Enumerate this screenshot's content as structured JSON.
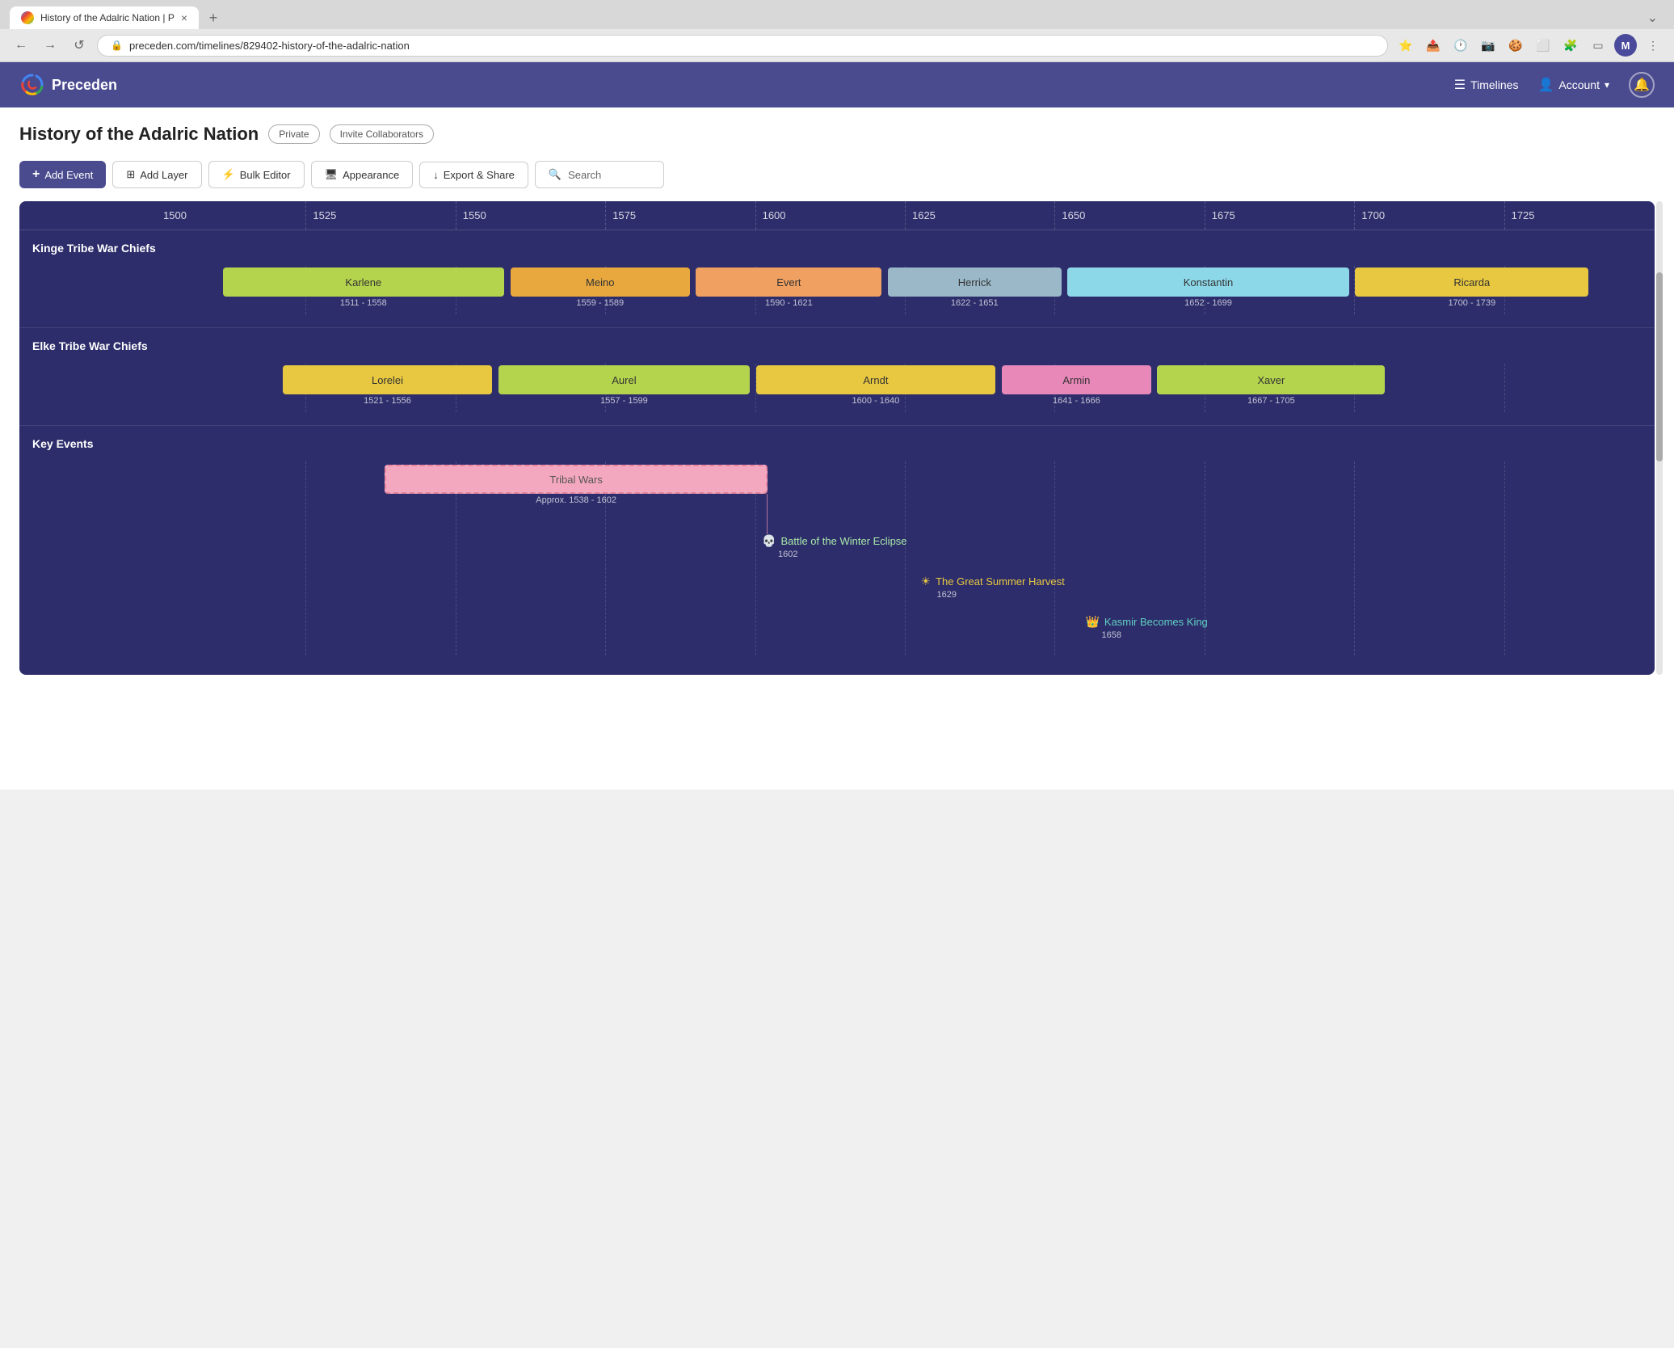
{
  "browser": {
    "tab_title": "History of the Adalric Nation | P",
    "url": "preceden.com/timelines/829402-history-of-the-adalric-nation",
    "profile_letter": "M",
    "new_tab_symbol": "+"
  },
  "header": {
    "logo_text": "Preceden",
    "timelines_label": "Timelines",
    "account_label": "Account"
  },
  "page": {
    "title": "History of the Adalric Nation",
    "private_badge": "Private",
    "invite_badge": "Invite Collaborators"
  },
  "toolbar": {
    "add_event_label": "Add Event",
    "add_layer_label": "Add Layer",
    "bulk_editor_label": "Bulk Editor",
    "appearance_label": "Appearance",
    "export_share_label": "Export & Share",
    "search_placeholder": "Search"
  },
  "timeline": {
    "years": [
      "1500",
      "1525",
      "1550",
      "1575",
      "1600",
      "1625",
      "1650",
      "1675",
      "1700",
      "1725"
    ],
    "sections": [
      {
        "id": "kinge",
        "name": "Kinge Tribe War Chiefs",
        "events": [
          {
            "name": "Karlene",
            "start": 1511,
            "end": 1558,
            "color": "#b5d44e",
            "dates": "1511 - 1558"
          },
          {
            "name": "Meino",
            "start": 1559,
            "end": 1589,
            "color": "#e8a83e",
            "dates": "1559 - 1589"
          },
          {
            "name": "Evert",
            "start": 1590,
            "end": 1621,
            "color": "#f0a060",
            "dates": "1590 - 1621"
          },
          {
            "name": "Herrick",
            "start": 1622,
            "end": 1651,
            "color": "#9ab8c8",
            "dates": "1622 - 1651"
          },
          {
            "name": "Konstantin",
            "start": 1652,
            "end": 1699,
            "color": "#8dd8e8",
            "dates": "1652 - 1699"
          },
          {
            "name": "Ricarda",
            "start": 1700,
            "end": 1739,
            "color": "#e8c840",
            "dates": "1700 - 1739"
          }
        ]
      },
      {
        "id": "elke",
        "name": "Elke Tribe War Chiefs",
        "events": [
          {
            "name": "Lorelei",
            "start": 1521,
            "end": 1556,
            "color": "#e8c840",
            "dates": "1521 - 1556"
          },
          {
            "name": "Aurel",
            "start": 1557,
            "end": 1599,
            "color": "#b5d44e",
            "dates": "1557 - 1599"
          },
          {
            "name": "Arndt",
            "start": 1600,
            "end": 1640,
            "color": "#e8c840",
            "dates": "1600 - 1640"
          },
          {
            "name": "Armin",
            "start": 1641,
            "end": 1666,
            "color": "#e888b8",
            "dates": "1641 - 1666"
          },
          {
            "name": "Xaver",
            "start": 1667,
            "end": 1705,
            "color": "#b5d44e",
            "dates": "1667 - 1705"
          }
        ]
      },
      {
        "id": "key_events",
        "name": "Key Events",
        "point_events": [
          {
            "name": "Battle of the Winter Eclipse",
            "year": 1602,
            "icon": "💀",
            "color": "#a8e8a8",
            "icon_color": "#60d060"
          },
          {
            "name": "The Great Summer Harvest",
            "year": 1629,
            "icon": "☀",
            "color": "#e8c840",
            "icon_color": "#e8c840"
          },
          {
            "name": "Kasmir Becomes King",
            "year": 1658,
            "icon": "👑",
            "color": "#60d0c0",
            "icon_color": "#60d0c0"
          }
        ],
        "range_events": [
          {
            "name": "Tribal Wars",
            "start": 1538,
            "end": 1602,
            "color": "#f4a8c0",
            "dates": "Approx. 1538 - 1602"
          }
        ]
      }
    ]
  },
  "colors": {
    "header_bg": "#4a4a8f",
    "timeline_bg": "#2d2d6b",
    "primary_btn": "#4a4a8f"
  }
}
